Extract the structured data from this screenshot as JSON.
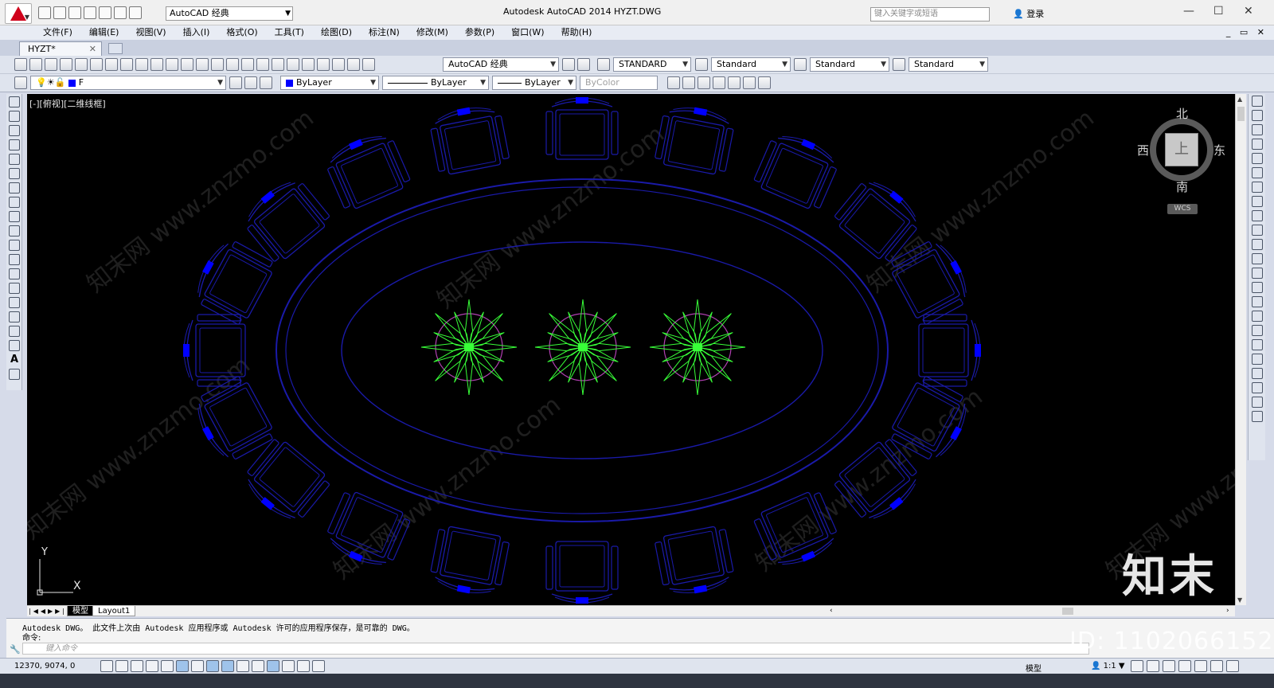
{
  "app": {
    "title": "Autodesk AutoCAD 2014",
    "file": "HYZT.DWG",
    "workspace": "AutoCAD 经典",
    "search_placeholder": "键入关键字或短语",
    "login": "登录"
  },
  "menu": [
    "文件(F)",
    "编辑(E)",
    "视图(V)",
    "插入(I)",
    "格式(O)",
    "工具(T)",
    "绘图(D)",
    "标注(N)",
    "修改(M)",
    "参数(P)",
    "窗口(W)",
    "帮助(H)"
  ],
  "tab": {
    "name": "HYZT*"
  },
  "toolbar1": {
    "workspace": "AutoCAD 经典",
    "text_style": "STANDARD",
    "dim_style": "Standard",
    "table_style": "Standard",
    "mleader_style": "Standard"
  },
  "toolbar2": {
    "layer": "F",
    "color": "ByLayer",
    "linetype": "ByLayer",
    "lineweight": "ByLayer",
    "plotstyle": "ByColor"
  },
  "viewport": {
    "label": "[-][俯视][二维线框]"
  },
  "viewcube": {
    "north": "北",
    "south": "南",
    "east": "东",
    "west": "西",
    "face": "上",
    "wcs": "WCS"
  },
  "ucs": {
    "x": "X",
    "y": "Y"
  },
  "layout_tabs": [
    "模型",
    "Layout1"
  ],
  "command": {
    "history": "Autodesk DWG。  此文件上次由 Autodesk 应用程序或 Autodesk 许可的应用程序保存，是可靠的 DWG。",
    "prompt": "命令:",
    "input_placeholder": "键入命令"
  },
  "status": {
    "coords": "12370, 9074, 0",
    "model": "模型",
    "scale": "1:1"
  },
  "watermarks": {
    "site": "知末网 www.znzmo.com",
    "brand": "知末",
    "id": "ID: 1102066152"
  },
  "colors": {
    "canvas": "#000000",
    "furniture": "#1a1aa8",
    "accent": "#0000ff",
    "plant": "#38ff38",
    "plant_ring": "#b040b0"
  }
}
